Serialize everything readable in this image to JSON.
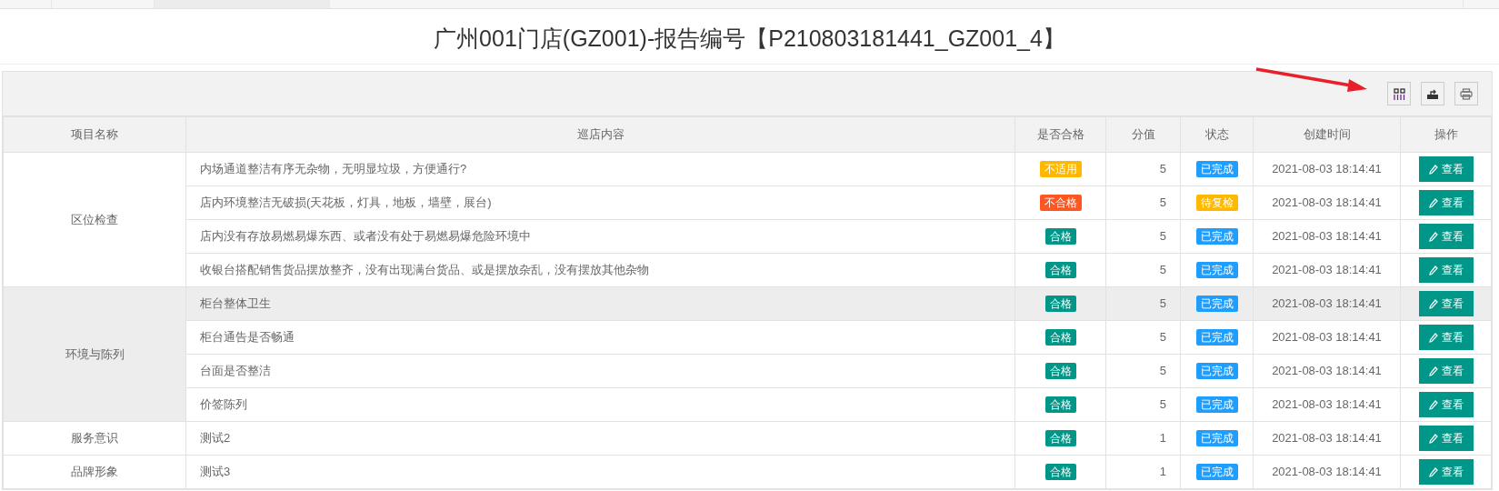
{
  "title": "广州001门店(GZ001)-报告编号【P210803181441_GZ001_4】",
  "columns": [
    "项目名称",
    "巡店内容",
    "是否合格",
    "分值",
    "状态",
    "创建时间",
    "操作"
  ],
  "groups": [
    {
      "name": "区位检查",
      "highlighted": false,
      "rows": [
        {
          "content": "内场通道整洁有序无杂物，无明显垃圾，方便通行?",
          "result": {
            "kind": "na",
            "text": "不适用"
          },
          "score": "5",
          "status": {
            "kind": "done",
            "text": "已完成"
          },
          "time": "2021-08-03 18:14:41",
          "action": "查看",
          "highlighted": false
        },
        {
          "content": "店内环境整洁无破损(天花板，灯具，地板，墙壁，展台)",
          "result": {
            "kind": "fail",
            "text": "不合格"
          },
          "score": "5",
          "status": {
            "kind": "recheck",
            "text": "待复检"
          },
          "time": "2021-08-03 18:14:41",
          "action": "查看",
          "highlighted": false
        },
        {
          "content": "店内没有存放易燃易爆东西、或者没有处于易燃易爆危险环境中",
          "result": {
            "kind": "pass",
            "text": "合格"
          },
          "score": "5",
          "status": {
            "kind": "done",
            "text": "已完成"
          },
          "time": "2021-08-03 18:14:41",
          "action": "查看",
          "highlighted": false
        },
        {
          "content": "收银台搭配销售货品摆放整齐，没有出现满台货品、或是摆放杂乱，没有摆放其他杂物",
          "result": {
            "kind": "pass",
            "text": "合格"
          },
          "score": "5",
          "status": {
            "kind": "done",
            "text": "已完成"
          },
          "time": "2021-08-03 18:14:41",
          "action": "查看",
          "highlighted": false
        }
      ]
    },
    {
      "name": "环境与陈列",
      "highlighted": true,
      "rows": [
        {
          "content": "柜台整体卫生",
          "result": {
            "kind": "pass",
            "text": "合格"
          },
          "score": "5",
          "status": {
            "kind": "done",
            "text": "已完成"
          },
          "time": "2021-08-03 18:14:41",
          "action": "查看",
          "highlighted": true
        },
        {
          "content": "柜台通告是否畅通",
          "result": {
            "kind": "pass",
            "text": "合格"
          },
          "score": "5",
          "status": {
            "kind": "done",
            "text": "已完成"
          },
          "time": "2021-08-03 18:14:41",
          "action": "查看",
          "highlighted": false
        },
        {
          "content": "台面是否整洁",
          "result": {
            "kind": "pass",
            "text": "合格"
          },
          "score": "5",
          "status": {
            "kind": "done",
            "text": "已完成"
          },
          "time": "2021-08-03 18:14:41",
          "action": "查看",
          "highlighted": false
        },
        {
          "content": "价签陈列",
          "result": {
            "kind": "pass",
            "text": "合格"
          },
          "score": "5",
          "status": {
            "kind": "done",
            "text": "已完成"
          },
          "time": "2021-08-03 18:14:41",
          "action": "查看",
          "highlighted": false
        }
      ]
    },
    {
      "name": "服务意识",
      "highlighted": false,
      "rows": [
        {
          "content": "测试2",
          "result": {
            "kind": "pass",
            "text": "合格"
          },
          "score": "1",
          "status": {
            "kind": "done",
            "text": "已完成"
          },
          "time": "2021-08-03 18:14:41",
          "action": "查看",
          "highlighted": false
        }
      ]
    },
    {
      "name": "品牌形象",
      "highlighted": false,
      "rows": [
        {
          "content": "测试3",
          "result": {
            "kind": "pass",
            "text": "合格"
          },
          "score": "1",
          "status": {
            "kind": "done",
            "text": "已完成"
          },
          "time": "2021-08-03 18:14:41",
          "action": "查看",
          "highlighted": false
        }
      ]
    }
  ]
}
